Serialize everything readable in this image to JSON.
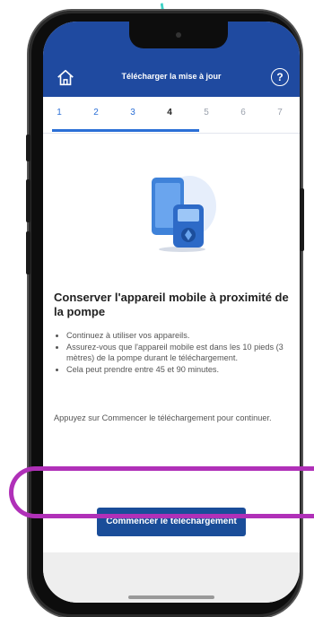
{
  "header": {
    "title": "Télécharger la mise à jour",
    "help_symbol": "?"
  },
  "steps": {
    "items": [
      "1",
      "2",
      "3",
      "4",
      "5",
      "6",
      "7"
    ],
    "current": "4"
  },
  "content": {
    "heading": "Conserver l'appareil mobile à proximité de la pompe",
    "bullets": [
      "Continuez à utiliser vos appareils.",
      "Assurez-vous que l'appareil mobile est dans les 10 pieds (3 mètres) de la pompe durant le téléchargement.",
      "Cela peut prendre entre 45 et 90 minutes."
    ],
    "instruction": "Appuyez sur Commencer le téléchargement pour continuer."
  },
  "actions": {
    "start_download_label": "Commencer le téléchargement"
  },
  "colors": {
    "header_bg": "#1f4aa0",
    "accent": "#2b6fd6",
    "button_bg": "#1a4d99",
    "highlight": "#b030b8",
    "teal": "#2ccfc0"
  },
  "icons": {
    "home": "home-icon",
    "help": "help-icon",
    "illustration": "phone-and-pump-illustration"
  }
}
